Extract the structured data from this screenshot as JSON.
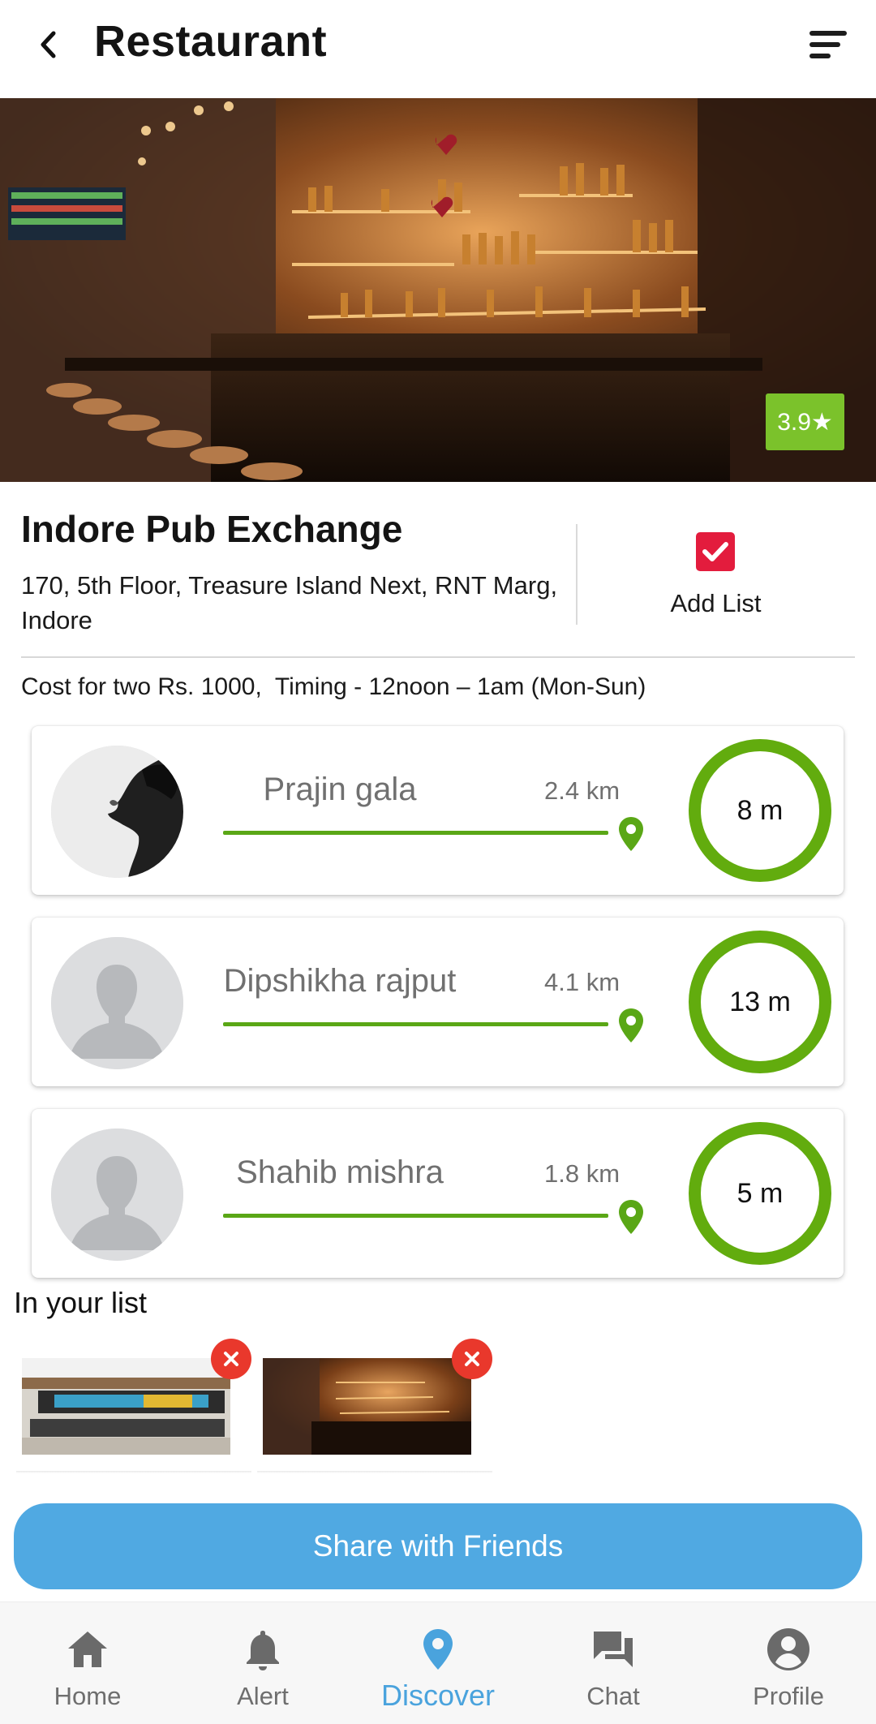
{
  "header": {
    "title": "Restaurant"
  },
  "hero": {
    "rating": "3.9★",
    "rating_color": "#7bc22b"
  },
  "venue": {
    "name": "Indore Pub Exchange",
    "address": "170, 5th Floor, Treasure Island Next, RNT Marg, Indore",
    "add_list_label": "Add List",
    "cost_timing": "Cost for two Rs. 1000,  Timing - 12noon – 1am (Mon-Sun)"
  },
  "friends": [
    {
      "name": "Prajin gala",
      "distance": "2.4 km",
      "time": "8 m",
      "avatar": "photo"
    },
    {
      "name": "Dipshikha rajput",
      "distance": "4.1 km",
      "time": "13 m",
      "avatar": "placeholder"
    },
    {
      "name": "Shahib mishra",
      "distance": "1.8 km",
      "time": "5 m",
      "avatar": "placeholder"
    }
  ],
  "your_list": {
    "heading": "In your list",
    "items": [
      {
        "thumb": "restaurant-interior"
      },
      {
        "thumb": "bar-interior"
      }
    ]
  },
  "share": {
    "label": "Share with Friends",
    "color": "#50a9e2"
  },
  "nav": {
    "items": [
      {
        "label": "Home",
        "icon": "home-icon"
      },
      {
        "label": "Alert",
        "icon": "bell-icon"
      },
      {
        "label": "Discover",
        "icon": "location-pin-icon",
        "active": true
      },
      {
        "label": "Chat",
        "icon": "chat-icon"
      },
      {
        "label": "Profile",
        "icon": "profile-icon"
      }
    ]
  },
  "colors": {
    "accent_green": "#62ac0e",
    "checkbox_red": "#e31c3d",
    "remove_red": "#e9382c",
    "active_blue": "#4aa3dd"
  }
}
